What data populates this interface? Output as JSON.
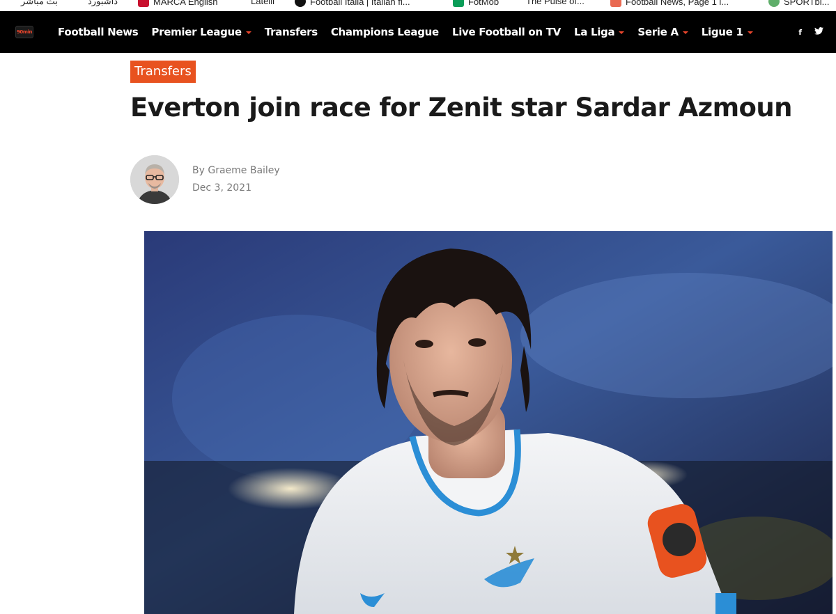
{
  "bookmarks": [
    {
      "label": "بثّ مباشر",
      "color": "#ffffff"
    },
    {
      "label": "داشبورد",
      "color": "#ffffff"
    },
    {
      "label": "MARCA English",
      "color": "#c8102e"
    },
    {
      "label": "Latelli",
      "color": "#ffffff"
    },
    {
      "label": "Football Italia | Italian fi...",
      "color": "#111111"
    },
    {
      "label": "FotMob",
      "color": "#0a9d58"
    },
    {
      "label": "The Pulse of...",
      "color": "#ffffff"
    },
    {
      "label": "Football News, Page 1 i...",
      "color": "#e96a52"
    },
    {
      "label": "SPORTbi...",
      "color": "#5fae6a"
    }
  ],
  "site": {
    "logo_text": "90min"
  },
  "nav": {
    "items": [
      {
        "label": "Football News",
        "has_dropdown": false
      },
      {
        "label": "Premier League",
        "has_dropdown": true
      },
      {
        "label": "Transfers",
        "has_dropdown": false
      },
      {
        "label": "Champions League",
        "has_dropdown": false
      },
      {
        "label": "Live Football on TV",
        "has_dropdown": false
      },
      {
        "label": "La Liga",
        "has_dropdown": true
      },
      {
        "label": "Serie A",
        "has_dropdown": true
      },
      {
        "label": "Ligue 1",
        "has_dropdown": true
      }
    ],
    "social": [
      {
        "label": "f",
        "icon": "facebook-icon"
      },
      {
        "label": "🐦",
        "icon": "twitter-icon"
      }
    ]
  },
  "article": {
    "category": "Transfers",
    "title": "Everton join race for Zenit star Sardar Azmoun",
    "byline_prefix": "By",
    "author": "Graeme Bailey",
    "date": "Dec 3, 2021"
  },
  "colors": {
    "accent": "#e8521f",
    "nav_bg": "#000000",
    "caret": "#e8452c"
  }
}
